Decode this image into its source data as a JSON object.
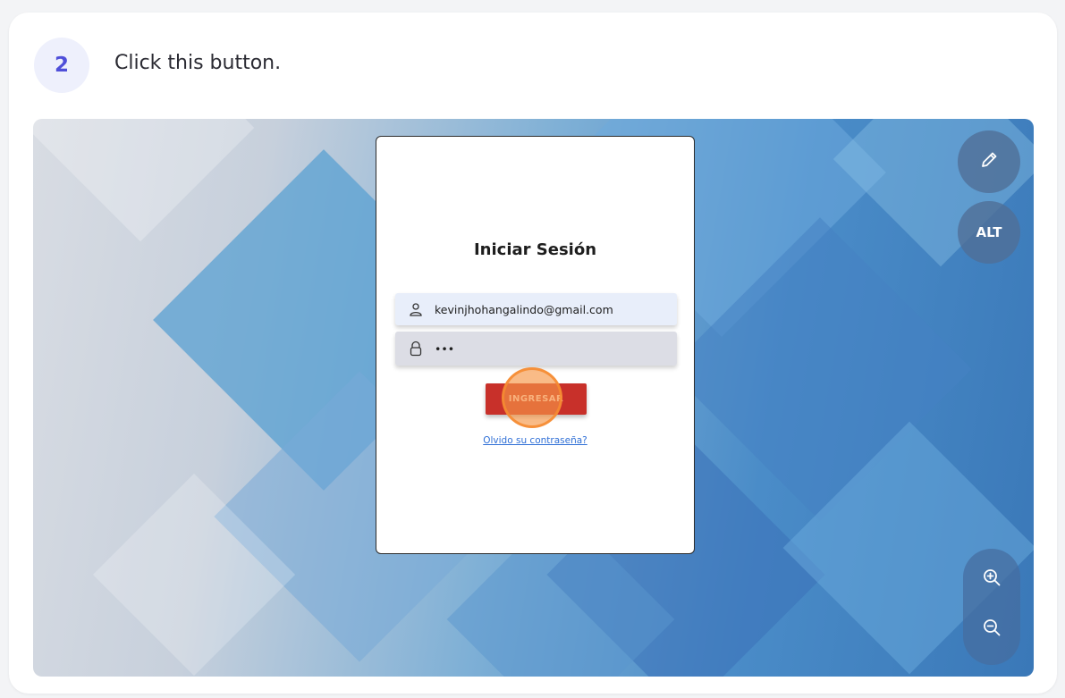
{
  "step": {
    "number": "2",
    "instruction": "Click this button."
  },
  "login": {
    "title": "Iniciar Sesión",
    "email_value": "kevinjhohangalindo@gmail.com",
    "password_value": "•••",
    "submit_label": "INGRESAR",
    "forgot_label": "Olvido su contraseña?"
  },
  "toolbar": {
    "alt_label": "ALT"
  },
  "icons": {
    "email_field": "user-icon",
    "password_field": "lock-icon",
    "edit": "pencil-icon",
    "zoom_in": "zoom-in-icon",
    "zoom_out": "zoom-out-icon"
  },
  "colors": {
    "step_accent": "#4f4fd9",
    "submit_button": "#c8302a",
    "click_marker": "#f58c32",
    "link": "#2f6fd6"
  }
}
